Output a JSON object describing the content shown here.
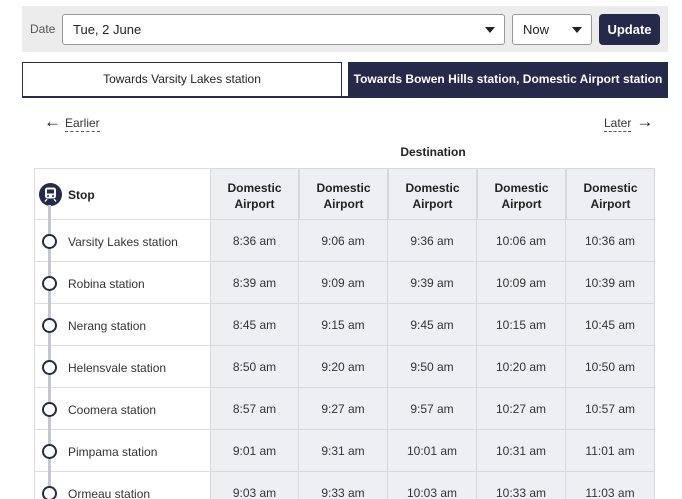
{
  "filters": {
    "date_label": "Date",
    "date_value": "Tue, 2 June",
    "time_value": "Now",
    "update_label": "Update"
  },
  "tabs": [
    {
      "label": "Towards Varsity Lakes station",
      "active": false
    },
    {
      "label": "Towards Bowen Hills station, Domestic Airport station",
      "active": true
    }
  ],
  "nav": {
    "earlier": "Earlier",
    "later": "Later"
  },
  "timetable": {
    "destination_heading": "Destination",
    "stop_heading": "Stop",
    "columns": [
      [
        "Domestic",
        "Airport"
      ],
      [
        "Domestic",
        "Airport"
      ],
      [
        "Domestic",
        "Airport"
      ],
      [
        "Domestic",
        "Airport"
      ],
      [
        "Domestic",
        "Airport"
      ]
    ],
    "rows": [
      {
        "stop": "Varsity Lakes station",
        "times": [
          "8:36 am",
          "9:06 am",
          "9:36 am",
          "10:06 am",
          "10:36 am"
        ]
      },
      {
        "stop": "Robina station",
        "times": [
          "8:39 am",
          "9:09 am",
          "9:39 am",
          "10:09 am",
          "10:39 am"
        ]
      },
      {
        "stop": "Nerang station",
        "times": [
          "8:45 am",
          "9:15 am",
          "9:45 am",
          "10:15 am",
          "10:45 am"
        ]
      },
      {
        "stop": "Helensvale station",
        "times": [
          "8:50 am",
          "9:20 am",
          "9:50 am",
          "10:20 am",
          "10:50 am"
        ]
      },
      {
        "stop": "Coomera station",
        "times": [
          "8:57 am",
          "9:27 am",
          "9:57 am",
          "10:27 am",
          "10:57 am"
        ]
      },
      {
        "stop": "Pimpama station",
        "times": [
          "9:01 am",
          "9:31 am",
          "10:01 am",
          "10:31 am",
          "11:01 am"
        ]
      },
      {
        "stop": "Ormeau station",
        "times": [
          "9:03 am",
          "9:33 am",
          "10:03 am",
          "10:33 am",
          "11:03 am"
        ]
      }
    ]
  },
  "colors": {
    "brand": "#262a4a",
    "cell_bg": "#eeeff2",
    "route_line": "#c5c6d0"
  }
}
